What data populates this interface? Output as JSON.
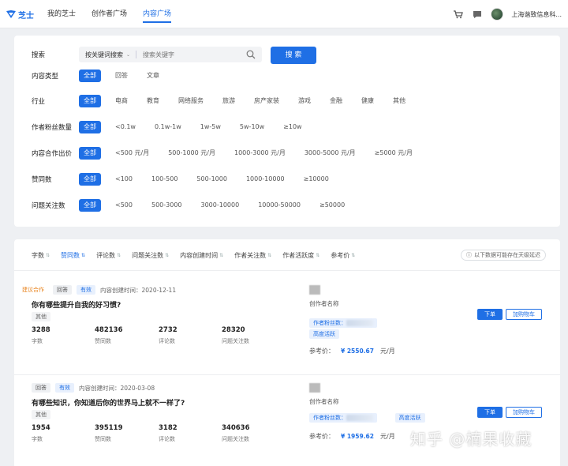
{
  "header": {
    "logo_text": "芝士",
    "nav": [
      {
        "label": "我的芝士",
        "active": false
      },
      {
        "label": "创作者广场",
        "active": false
      },
      {
        "label": "内容广场",
        "active": true
      }
    ],
    "company": "上海谐致信息科..."
  },
  "filters": {
    "search": {
      "label": "搜索",
      "type_value": "按关键词搜索",
      "placeholder": "搜索关键字",
      "button": "搜 索"
    },
    "content_type": {
      "label": "内容类型",
      "options": [
        "全部",
        "回答",
        "文章"
      ]
    },
    "industry": {
      "label": "行业",
      "options": [
        "全部",
        "电商",
        "教育",
        "网络服务",
        "旅游",
        "房产家装",
        "游戏",
        "金融",
        "健康",
        "其他"
      ]
    },
    "fans": {
      "label": "作者粉丝数量",
      "options": [
        "全部",
        "<0.1w",
        "0.1w-1w",
        "1w-5w",
        "5w-10w",
        "≥10w"
      ]
    },
    "price": {
      "label": "内容合作出价",
      "options": [
        "全部",
        "<500 元/月",
        "500-1000 元/月",
        "1000-3000 元/月",
        "3000-5000 元/月",
        "≥5000 元/月"
      ]
    },
    "likes": {
      "label": "赞同数",
      "options": [
        "全部",
        "<100",
        "100-500",
        "500-1000",
        "1000-10000",
        "≥10000"
      ]
    },
    "followers": {
      "label": "问题关注数",
      "options": [
        "全部",
        "<500",
        "500-3000",
        "3000-10000",
        "10000-50000",
        "≥50000"
      ]
    }
  },
  "sortbar": {
    "sorts": [
      {
        "label": "字数",
        "active": false
      },
      {
        "label": "赞同数",
        "active": true
      },
      {
        "label": "评论数",
        "active": false
      },
      {
        "label": "问题关注数",
        "active": false
      },
      {
        "label": "内容创建时间",
        "active": false
      },
      {
        "label": "作者关注数",
        "active": false
      },
      {
        "label": "作者活跃度",
        "active": false
      },
      {
        "label": "参考价",
        "active": false
      }
    ],
    "notice": "以下数据可能存在天级延迟"
  },
  "cards": [
    {
      "tags": [
        "建议合作",
        "回答",
        "有效"
      ],
      "created": "内容创建时间：2020-12-11",
      "title": "你有哪些提升自我的好习惯?",
      "category": "其他",
      "stats": [
        {
          "value": "3288",
          "label": "字数"
        },
        {
          "value": "482136",
          "label": "赞同数"
        },
        {
          "value": "2732",
          "label": "评论数"
        },
        {
          "value": "28320",
          "label": "问题关注数"
        }
      ],
      "author_name": "创作者名称",
      "fans_label": "作者粉丝数：",
      "activity": "高度活跃",
      "price_label": "参考价：",
      "price": "¥ 2550.67",
      "price_unit": "元/月",
      "order": "下单",
      "cart": "加购物车"
    },
    {
      "tags": [
        "回答",
        "有效"
      ],
      "created": "内容创建时间：2020-03-08",
      "title": "有哪些知识，你知道后你的世界马上就不一样了?",
      "category": "其他",
      "stats": [
        {
          "value": "1954",
          "label": "字数"
        },
        {
          "value": "395119",
          "label": "赞同数"
        },
        {
          "value": "3182",
          "label": "评论数"
        },
        {
          "value": "340636",
          "label": "问题关注数"
        }
      ],
      "author_name": "创作者名称",
      "fans_label": "作者粉丝数：",
      "activity": "高度活跃",
      "price_label": "参考价：",
      "price": "¥ 1959.62",
      "price_unit": "元/月",
      "order": "下单",
      "cart": "加购物车"
    }
  ],
  "watermark": "知乎 @楠果收藏",
  "colors": {
    "accent": "#1f6fe5",
    "orange": "#e8831e",
    "background": "#eef0f3"
  }
}
